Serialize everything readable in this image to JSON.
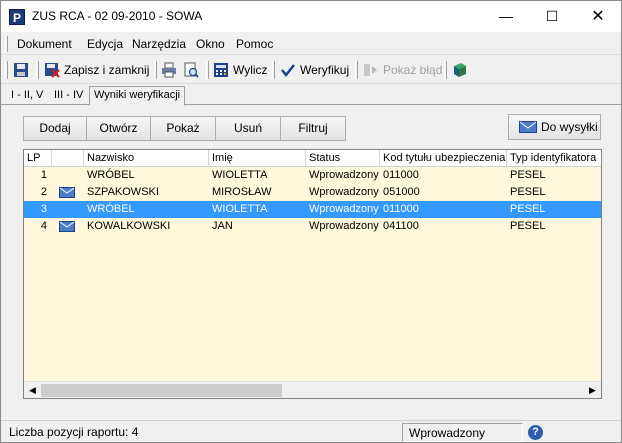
{
  "window": {
    "title": "ZUS RCA - 02 09-2010 - SOWA",
    "app_icon": "P",
    "controls": {
      "minimize": "—",
      "maximize": "☐",
      "close": "✕"
    }
  },
  "menu": {
    "items": [
      {
        "label": "Dokument",
        "accel": "D"
      },
      {
        "label": "Edycja",
        "accel": "E"
      },
      {
        "label": "Narzędzia",
        "accel": "N"
      },
      {
        "label": "Okno",
        "accel": "k"
      },
      {
        "label": "Pomoc",
        "accel": "m"
      }
    ]
  },
  "toolbar": {
    "save_close_label": "Zapisz i zamknij",
    "calculate_label": "Wylicz",
    "verify_label": "Weryfikuj",
    "show_error_label": "Pokaż błąd"
  },
  "tabs": [
    {
      "label": "I - II, V"
    },
    {
      "label": "III - IV"
    },
    {
      "label": "Wyniki weryfikacji"
    }
  ],
  "actions": {
    "add": "Dodaj",
    "open": "Otwórz",
    "show": "Pokaż",
    "delete": "Usuń",
    "filter": "Filtruj",
    "to_send": "Do wysyłki"
  },
  "grid": {
    "columns": [
      "LP",
      "",
      "Nazwisko",
      "Imię",
      "Status",
      "Kod tytułu ubezpieczenia",
      "Typ identyfikatora"
    ],
    "rows": [
      {
        "lp": "1",
        "envelope": false,
        "surname": "WRÓBEL",
        "name": "WIOLETTA",
        "status": "Wprowadzony",
        "code": "011000",
        "id_type": "PESEL",
        "selected": false
      },
      {
        "lp": "2",
        "envelope": true,
        "surname": "SZPAKOWSKI",
        "name": "MIROSŁAW",
        "status": "Wprowadzony",
        "code": "051000",
        "id_type": "PESEL",
        "selected": false
      },
      {
        "lp": "3",
        "envelope": false,
        "surname": "WRÓBEL",
        "name": "WIOLETTA",
        "status": "Wprowadzony",
        "code": "011000",
        "id_type": "PESEL",
        "selected": true
      },
      {
        "lp": "4",
        "envelope": true,
        "surname": "KOWALKOWSKI",
        "name": "JAN",
        "status": "Wprowadzony",
        "code": "041100",
        "id_type": "PESEL",
        "selected": false
      }
    ]
  },
  "scrollbar": {
    "left_arrow": "◀",
    "right_arrow": "▶"
  },
  "status": {
    "count_label": "Liczba pozycji raportu: 4",
    "state": "Wprowadzony",
    "help_icon": "?"
  },
  "colors": {
    "grid_background": "#fff8dc",
    "selection": "#3399ff",
    "title_icon": "#1a3a7a"
  }
}
